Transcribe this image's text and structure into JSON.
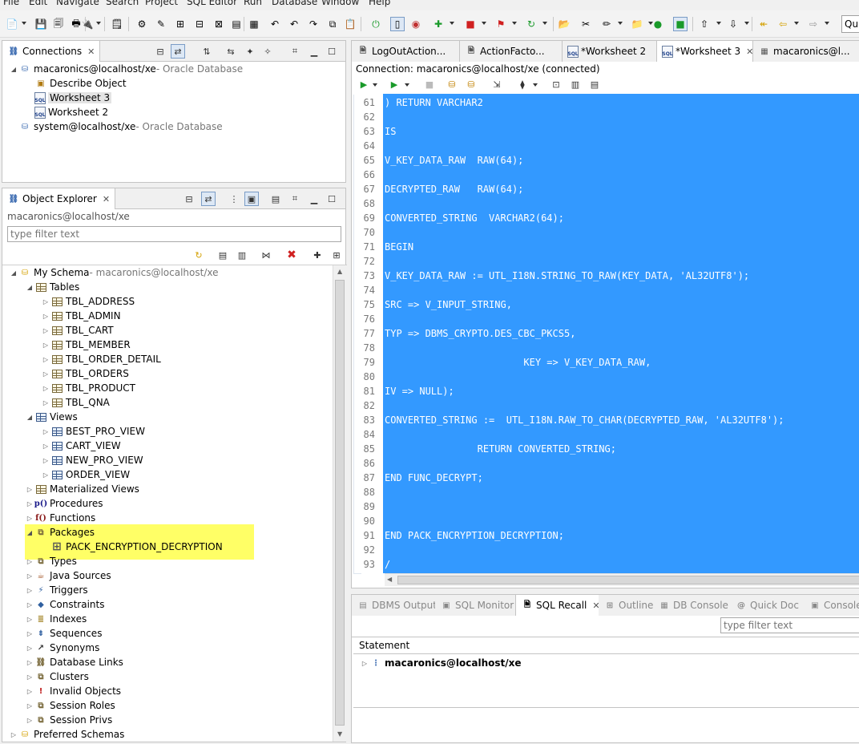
{
  "menu": [
    "File",
    "Edit",
    "Navigate",
    "Search",
    "Project",
    "SQL Editor",
    "Run",
    "Database",
    "Window",
    "Help"
  ],
  "toolbar": {
    "quick_access_placeholder": "Qu"
  },
  "connections": {
    "tab_label": "Connections",
    "items": [
      {
        "name": "macaronics@localhost/xe",
        "suffix": " - Oracle Database",
        "expanded": true
      },
      {
        "name": "Describe Object"
      },
      {
        "name": "Worksheet 3",
        "selected": true
      },
      {
        "name": "Worksheet 2"
      },
      {
        "name": "system@localhost/xe",
        "suffix": " - Oracle Database"
      }
    ]
  },
  "object_explorer": {
    "tab_label": "Object Explorer",
    "connection": "macaronics@localhost/xe",
    "filter_placeholder": "type filter text",
    "schema": {
      "name": "My Schema",
      "suffix": " - macaronics@localhost/xe"
    },
    "tables_label": "Tables",
    "tables": [
      "TBL_ADDRESS",
      "TBL_ADMIN",
      "TBL_CART",
      "TBL_MEMBER",
      "TBL_ORDER_DETAIL",
      "TBL_ORDERS",
      "TBL_PRODUCT",
      "TBL_QNA"
    ],
    "views_label": "Views",
    "views": [
      "BEST_PRO_VIEW",
      "CART_VIEW",
      "NEW_PRO_VIEW",
      "ORDER_VIEW"
    ],
    "mid_categories": [
      "Materialized Views",
      "Procedures",
      "Functions"
    ],
    "packages_label": "Packages",
    "packages": [
      "PACK_ENCRYPTION_DECRYPTION"
    ],
    "rest_categories": [
      "Types",
      "Java Sources",
      "Triggers",
      "Constraints",
      "Indexes",
      "Sequences",
      "Synonyms",
      "Database Links",
      "Clusters",
      "Invalid Objects",
      "Session Roles",
      "Session Privs"
    ],
    "preferred": "Preferred Schemas"
  },
  "editor": {
    "tabs": [
      "LogOutAction...",
      "ActionFacto...",
      "*Worksheet 2",
      "*Worksheet 3",
      "macaronics@l..."
    ],
    "active_tab": "*Worksheet 3",
    "connection_status": "Connection: macaronics@localhost/xe (connected)",
    "lines": [
      {
        "n": "61",
        "t": ") RETURN VARCHAR2"
      },
      {
        "n": "62",
        "t": ""
      },
      {
        "n": "63",
        "t": "IS"
      },
      {
        "n": "64",
        "t": ""
      },
      {
        "n": "65",
        "t": "V_KEY_DATA_RAW  RAW(64);"
      },
      {
        "n": "66",
        "t": ""
      },
      {
        "n": "67",
        "t": "DECRYPTED_RAW   RAW(64);"
      },
      {
        "n": "68",
        "t": ""
      },
      {
        "n": "69",
        "t": "CONVERTED_STRING  VARCHAR2(64);"
      },
      {
        "n": "70",
        "t": ""
      },
      {
        "n": "71",
        "t": "BEGIN"
      },
      {
        "n": "72",
        "t": ""
      },
      {
        "n": "73",
        "t": "V_KEY_DATA_RAW := UTL_I18N.STRING_TO_RAW(KEY_DATA, 'AL32UTF8');"
      },
      {
        "n": "74",
        "t": ""
      },
      {
        "n": "75",
        "t": "SRC => V_INPUT_STRING,"
      },
      {
        "n": "76",
        "t": ""
      },
      {
        "n": "77",
        "t": "TYP => DBMS_CRYPTO.DES_CBC_PKCS5,"
      },
      {
        "n": "78",
        "t": ""
      },
      {
        "n": "79",
        "t": "                        KEY => V_KEY_DATA_RAW,"
      },
      {
        "n": "80",
        "t": ""
      },
      {
        "n": "81",
        "t": "IV => NULL);"
      },
      {
        "n": "82",
        "t": ""
      },
      {
        "n": "83",
        "t": "CONVERTED_STRING :=  UTL_I18N.RAW_TO_CHAR(DECRYPTED_RAW, 'AL32UTF8');"
      },
      {
        "n": "84",
        "t": ""
      },
      {
        "n": "85",
        "t": "                RETURN CONVERTED_STRING;"
      },
      {
        "n": "86",
        "t": ""
      },
      {
        "n": "87",
        "t": "END FUNC_DECRYPT;"
      },
      {
        "n": "88",
        "t": ""
      },
      {
        "n": "89",
        "t": ""
      },
      {
        "n": "90",
        "t": ""
      },
      {
        "n": "91",
        "t": "END PACK_ENCRYPTION_DECRYPTION;"
      },
      {
        "n": "92",
        "t": ""
      },
      {
        "n": "93",
        "t": "/"
      }
    ]
  },
  "bottom": {
    "tabs": [
      "DBMS Output",
      "SQL Monitor",
      "SQL Recall",
      "Outline",
      "DB Console",
      "Quick Doc",
      "Console"
    ],
    "active_tab": "SQL Recall",
    "filter_placeholder": "type filter text",
    "statement_header": "Statement",
    "recall_item": "macaronics@localhost/xe"
  },
  "colors": {
    "selection": "#3399ff",
    "highlight": "#ffff66"
  }
}
